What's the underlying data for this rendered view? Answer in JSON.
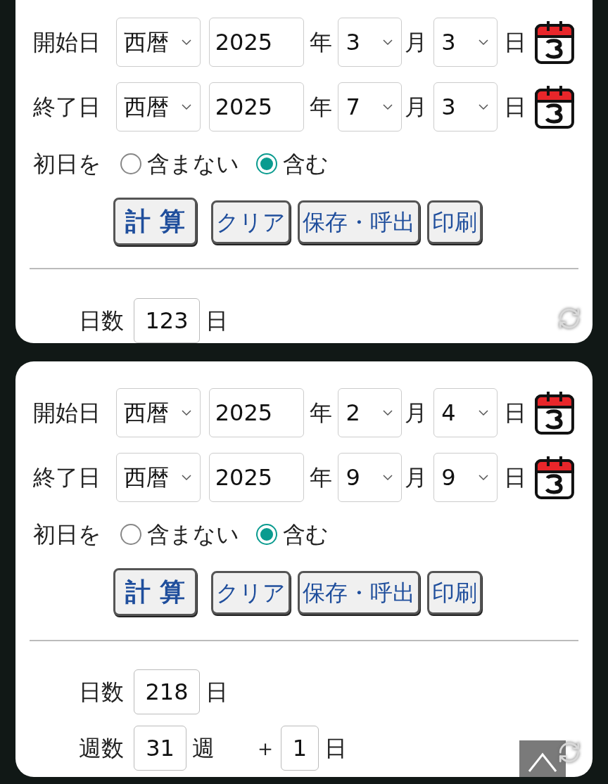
{
  "calculators": [
    {
      "start": {
        "label": "開始日",
        "era": "西暦",
        "year": "2025",
        "year_unit": "年",
        "month": "3",
        "month_unit": "月",
        "day": "3",
        "day_unit": "日"
      },
      "end": {
        "label": "終了日",
        "era": "西暦",
        "year": "2025",
        "year_unit": "年",
        "month": "7",
        "month_unit": "月",
        "day": "3",
        "day_unit": "日"
      },
      "first_day": {
        "label": "初日を",
        "options": [
          {
            "label": "含まない",
            "selected": false
          },
          {
            "label": "含む",
            "selected": true
          }
        ]
      },
      "buttons": [
        {
          "label": "計 算",
          "kind": "primary"
        },
        {
          "label": "クリア",
          "kind": "normal"
        },
        {
          "label": "保存・呼出",
          "kind": "normal"
        },
        {
          "label": "印刷",
          "kind": "normal"
        }
      ],
      "results": [
        {
          "kind": "days",
          "label": "日数",
          "value": "123",
          "unit": "日"
        }
      ]
    },
    {
      "start": {
        "label": "開始日",
        "era": "西暦",
        "year": "2025",
        "year_unit": "年",
        "month": "2",
        "month_unit": "月",
        "day": "4",
        "day_unit": "日"
      },
      "end": {
        "label": "終了日",
        "era": "西暦",
        "year": "2025",
        "year_unit": "年",
        "month": "9",
        "month_unit": "月",
        "day": "9",
        "day_unit": "日"
      },
      "first_day": {
        "label": "初日を",
        "options": [
          {
            "label": "含まない",
            "selected": false
          },
          {
            "label": "含む",
            "selected": true
          }
        ]
      },
      "buttons": [
        {
          "label": "計 算",
          "kind": "primary"
        },
        {
          "label": "クリア",
          "kind": "normal"
        },
        {
          "label": "保存・呼出",
          "kind": "normal"
        },
        {
          "label": "印刷",
          "kind": "normal"
        }
      ],
      "results": [
        {
          "kind": "days",
          "label": "日数",
          "value": "218",
          "unit": "日"
        },
        {
          "kind": "weeks",
          "label": "週数",
          "value": "31",
          "unit": "週",
          "plus": "＋",
          "extra_value": "1",
          "extra_unit": "日"
        }
      ]
    }
  ]
}
